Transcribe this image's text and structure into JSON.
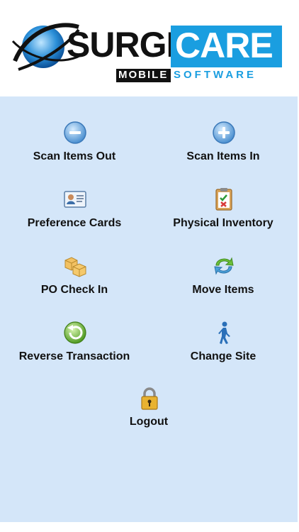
{
  "logo": {
    "primary": "SURGI",
    "secondary": "CARE",
    "sub_left": "MOBILE",
    "sub_right": "SOFTWARE",
    "colors": {
      "brand_blue": "#1a9ee0",
      "black": "#111111"
    }
  },
  "menu": {
    "background": "#d4e6f9",
    "items": [
      {
        "label": "Scan Items Out",
        "icon": "minus-circle-icon"
      },
      {
        "label": "Scan Items In",
        "icon": "plus-circle-icon"
      },
      {
        "label": "Preference Cards",
        "icon": "id-card-icon"
      },
      {
        "label": "Physical Inventory",
        "icon": "clipboard-check-icon"
      },
      {
        "label": "PO Check In",
        "icon": "boxes-icon"
      },
      {
        "label": "Move Items",
        "icon": "refresh-arrows-icon"
      },
      {
        "label": "Reverse Transaction",
        "icon": "undo-arrow-icon"
      },
      {
        "label": "Change Site",
        "icon": "walking-person-icon"
      },
      {
        "label": "Logout",
        "icon": "padlock-icon"
      }
    ]
  }
}
